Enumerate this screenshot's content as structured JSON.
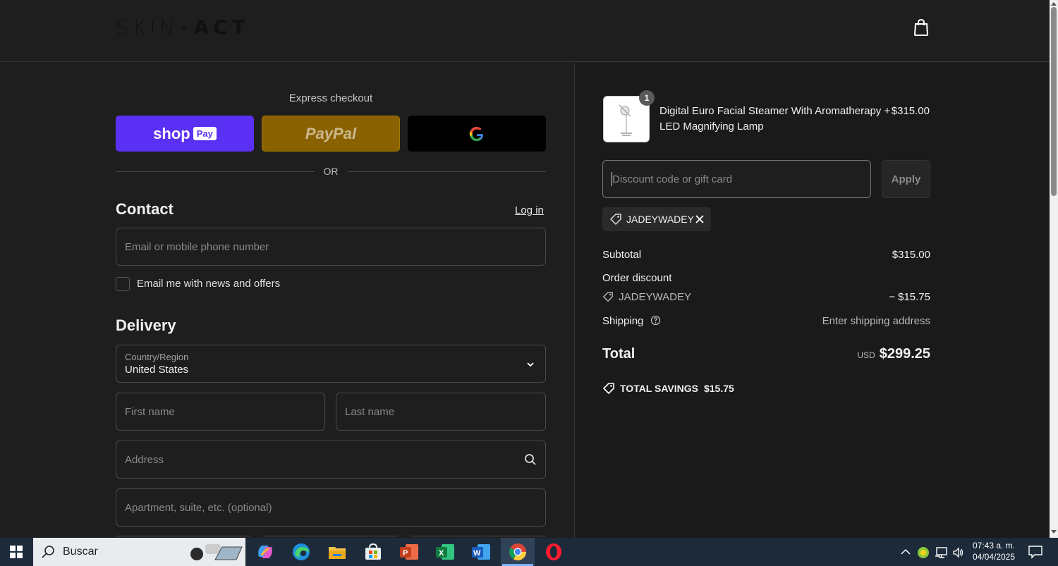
{
  "brand": {
    "logo_left": "SKIN",
    "logo_plus": "+",
    "logo_right": "ACT"
  },
  "express": {
    "label": "Express checkout",
    "shop_label": "shop",
    "shop_pay_tag": "Pay",
    "paypal_label": "PayPal",
    "or_label": "OR"
  },
  "contact": {
    "title": "Contact",
    "login_label": "Log in",
    "email_placeholder": "Email or mobile phone number",
    "newsletter_label": "Email me with news and offers"
  },
  "delivery": {
    "title": "Delivery",
    "country_label": "Country/Region",
    "country_value": "United States",
    "first_name_placeholder": "First name",
    "last_name_placeholder": "Last name",
    "address_placeholder": "Address",
    "apartment_placeholder": "Apartment, suite, etc. (optional)"
  },
  "cart": {
    "quantity": "1",
    "product_name": "Digital Euro Facial Steamer With Aromatherapy + LED Magnifying Lamp",
    "product_price": "$315.00",
    "discount_placeholder": "Discount code or gift card",
    "apply_label": "Apply",
    "applied_code": "JADEYWADEY"
  },
  "summary": {
    "subtotal_label": "Subtotal",
    "subtotal_value": "$315.00",
    "order_discount_label": "Order discount",
    "discount_code": "JADEYWADEY",
    "discount_value": "− $15.75",
    "shipping_label": "Shipping",
    "shipping_value": "Enter shipping address",
    "total_label": "Total",
    "currency": "USD",
    "total_value": "$299.25",
    "savings_label": "TOTAL SAVINGS",
    "savings_value": "$15.75"
  },
  "taskbar": {
    "search_label": "Buscar",
    "time": "07:43 a. m.",
    "date": "04/04/2025"
  },
  "colors": {
    "shop_pay": "#5a31f4",
    "paypal": "#8a6100",
    "google_btn": "#000000",
    "background": "#1e1e1e",
    "taskbar": "#1c2a3a"
  },
  "icons": [
    "shopping-bag-icon",
    "google-g-icon",
    "chevron-down-icon",
    "search-icon",
    "tag-icon",
    "close-icon",
    "question-circle-icon",
    "windows-start-icon",
    "copilot-icon",
    "edge-icon",
    "file-explorer-icon",
    "store-icon",
    "powerpoint-icon",
    "excel-icon",
    "word-icon",
    "chrome-icon",
    "opera-icon",
    "notification-icon"
  ]
}
